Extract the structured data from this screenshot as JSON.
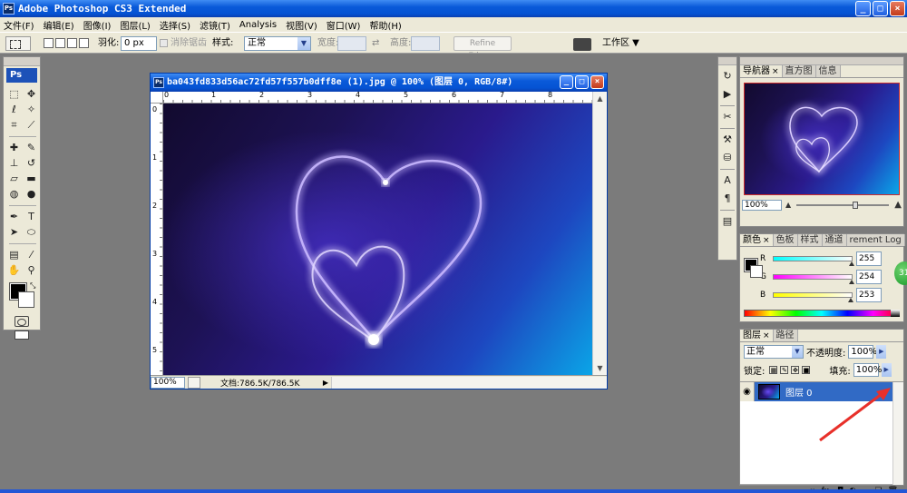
{
  "app": {
    "title": "Adobe Photoshop CS3 Extended",
    "ps_label": "Ps"
  },
  "menu": [
    "文件(F)",
    "编辑(E)",
    "图像(I)",
    "图层(L)",
    "选择(S)",
    "滤镜(T)",
    "Analysis",
    "视图(V)",
    "窗口(W)",
    "帮助(H)"
  ],
  "options": {
    "feather_label": "羽化:",
    "feather_value": "0 px",
    "antialias_label": "消除锯齿",
    "style_label": "样式:",
    "style_value": "正常",
    "width_label": "宽度:",
    "height_label": "高度:",
    "refine_edge": "Refine Edge...",
    "workspace": "工作区 ▼"
  },
  "document": {
    "title": "ba043fd833d56ac72fd57f557b0dff8e (1).jpg @ 100% (图层 0, RGB/8#)",
    "zoom": "100%",
    "doc_info": "文档:786.5K/786.5K",
    "ruler_top": [
      "0",
      "1",
      "2",
      "3",
      "4",
      "5",
      "6",
      "7",
      "8"
    ],
    "ruler_left": [
      "0",
      "1",
      "2",
      "3",
      "4",
      "5"
    ]
  },
  "navigator": {
    "tabs": [
      "导航器",
      "直方图",
      "信息"
    ],
    "zoom": "100%"
  },
  "color": {
    "tabs": [
      "颜色",
      "色板",
      "样式",
      "通道",
      "rement Log"
    ],
    "channels": [
      {
        "label": "R",
        "value": "255",
        "level": 1.0
      },
      {
        "label": "G",
        "value": "254",
        "level": 0.996
      },
      {
        "label": "B",
        "value": "253",
        "level": 0.992
      }
    ]
  },
  "layers": {
    "tabs": [
      "图层",
      "路径"
    ],
    "blend_mode": "正常",
    "opacity_label": "不透明度:",
    "opacity": "100%",
    "lock_label": "锁定:",
    "fill_label": "填充:",
    "fill": "100%",
    "items": [
      {
        "name": "图层 0",
        "visible": true,
        "selected": true
      }
    ]
  },
  "badge": "31"
}
